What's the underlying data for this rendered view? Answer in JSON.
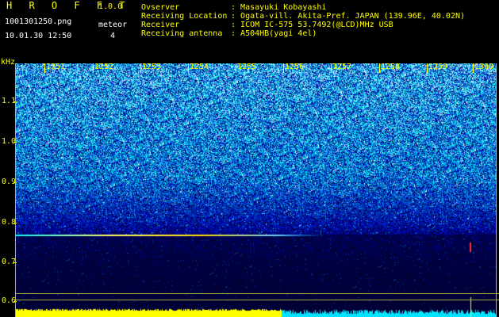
{
  "header": {
    "app_title": "H R O F F T",
    "app_version": "1.0.0",
    "file_name": "1001301250.png",
    "timestamp": "10.01.30 12:50",
    "detection_label": "meteor",
    "detection_count": "4"
  },
  "info": [
    {
      "key": "Ovserver",
      "value": "Masayuki Kobayashi"
    },
    {
      "key": "Receiving Location",
      "value": "Ogata-vill. Akita-Pref. JAPAN (139.96E, 40.02N)"
    },
    {
      "key": "Receiver",
      "value": "ICOM IC-575 53.7492(@LCD)MHz USB"
    },
    {
      "key": "Receiving antenna",
      "value": "A504HB(yagi 4el)"
    }
  ],
  "axis": {
    "y_unit": "kHz",
    "y_labels": [
      "1.1",
      "1.0",
      "0.9",
      "0.8",
      "0.7",
      "0.6"
    ],
    "x_labels": [
      "1251",
      "1252",
      "1253",
      "1254",
      "1255",
      "1256",
      "1257",
      "1258",
      "1259",
      "1300"
    ]
  },
  "colors": {
    "label": "#ffff00",
    "background": "#000000",
    "spectrum_low": "#0a1a6e",
    "spectrum_high": "#00ffff",
    "level_bar": "#ffff00",
    "level_bar_2": "#00e5ff"
  }
}
